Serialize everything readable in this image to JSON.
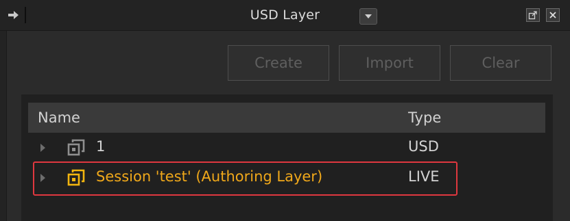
{
  "window": {
    "title": "USD Layer",
    "icons": {
      "dock": "dock-arrow-icon",
      "dropdown": "chevron-down-icon",
      "popout": "popout-icon",
      "close": "close-icon"
    }
  },
  "toolbar": {
    "create_label": "Create",
    "import_label": "Import",
    "clear_label": "Clear",
    "buttons_disabled": true
  },
  "table": {
    "columns": [
      "Name",
      "Type"
    ],
    "rows": [
      {
        "name": "1",
        "type": "USD",
        "icon": "layer-icon",
        "highlighted": false
      },
      {
        "name": "Session 'test' (Authoring Layer)",
        "type": "LIVE",
        "icon": "live-layer-icon",
        "highlighted": true
      }
    ]
  },
  "colors": {
    "background": "#2b2b2b",
    "live_accent": "#f0a81a",
    "highlight_border": "#e0383f"
  }
}
